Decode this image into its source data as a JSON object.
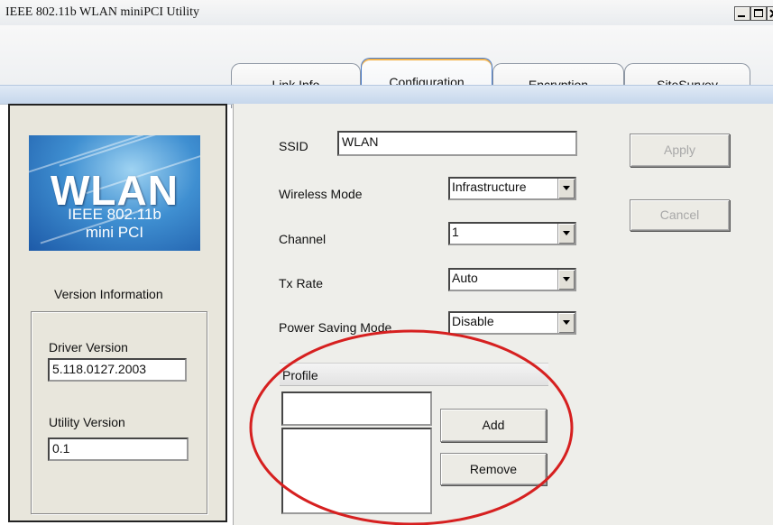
{
  "window": {
    "title": "IEEE 802.11b WLAN miniPCI Utility",
    "controls": [
      "minimize-icon",
      "maximize-icon",
      "close-icon"
    ]
  },
  "tabs": [
    {
      "label": "Link Info",
      "active": false
    },
    {
      "label": "Configuration",
      "active": true
    },
    {
      "label": "Encryption",
      "active": false
    },
    {
      "label": "SiteSurvey",
      "active": false
    }
  ],
  "sidebar": {
    "logo": {
      "title": "WLAN",
      "line1": "IEEE 802.11b",
      "line2": "mini PCI"
    },
    "version_heading": "Version Information",
    "driver_label": "Driver Version",
    "driver_value": "5.118.0127.2003",
    "utility_label": "Utility Version",
    "utility_value": "0.1"
  },
  "config": {
    "ssid_label": "SSID",
    "ssid_value": "WLAN",
    "wireless_mode_label": "Wireless Mode",
    "wireless_mode_value": "Infrastructure",
    "channel_label": "Channel",
    "channel_value": "1",
    "tx_rate_label": "Tx Rate",
    "tx_rate_value": "Auto",
    "power_saving_label": "Power Saving Mode",
    "power_saving_value": "Disable"
  },
  "actions": {
    "apply_label": "Apply",
    "cancel_label": "Cancel",
    "apply_enabled": false,
    "cancel_enabled": false
  },
  "profile": {
    "header": "Profile",
    "name_value": "",
    "list_items": [],
    "add_label": "Add",
    "remove_label": "Remove"
  },
  "annotation": {
    "shape": "ellipse",
    "color": "#d62020"
  }
}
